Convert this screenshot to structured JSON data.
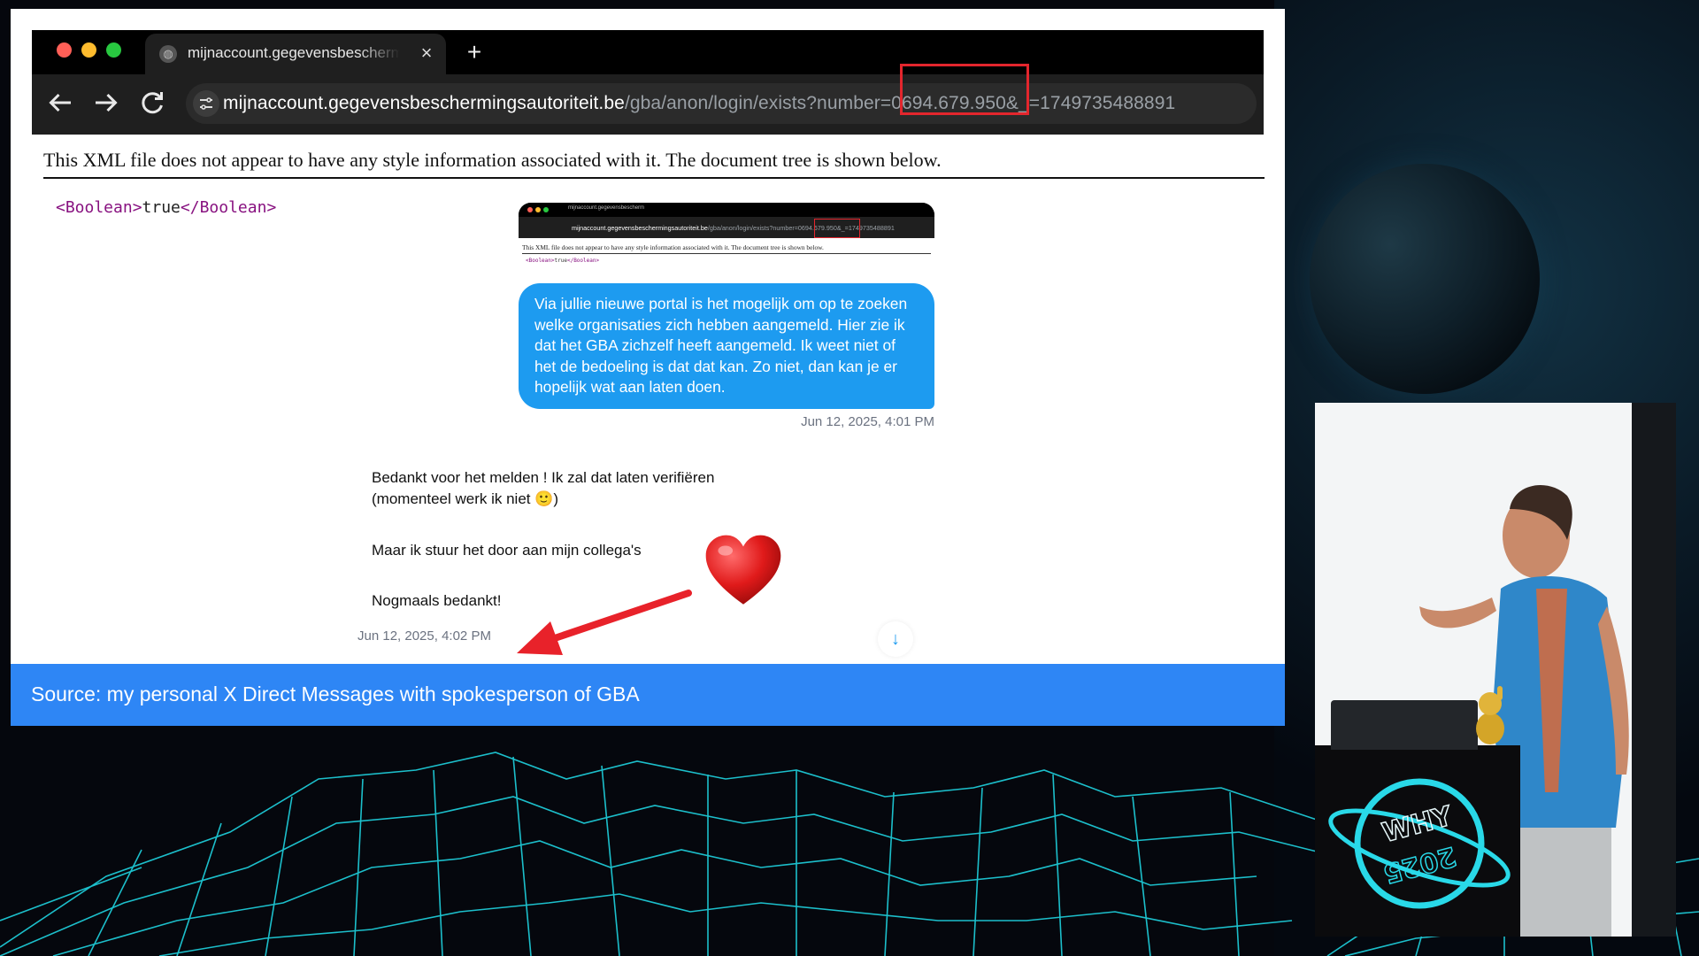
{
  "browser": {
    "tab_title": "mijnaccount.gegevensbescherm",
    "close_glyph": "×",
    "new_tab_glyph": "+",
    "url_host": "mijnaccount.gegevensbeschermingsautoriteit.be",
    "url_path": "/gba/anon/login/exists?number=0694.679.950&_=1749735488891",
    "highlighted_value": "0694.679.950"
  },
  "xml_page": {
    "notice": "This XML file does not appear to have any style information associated with it. The document tree is shown below.",
    "open_tag": "<Boolean>",
    "value": "true",
    "close_tag": "</Boolean>"
  },
  "dm": {
    "outgoing_message": "Via jullie nieuwe portal is het mogelijk om op te zoeken welke organisaties zich hebben aangemeld. Hier zie ik dat het GBA zichzelf heeft aangemeld. Ik weet niet of het de bedoeling is dat dat kan. Zo niet, dan kan je er hopelijk wat aan laten doen.",
    "outgoing_timestamp": "Jun 12, 2025, 4:01 PM",
    "incoming_messages": [
      "Bedankt voor het melden ! Ik zal dat laten verifiëren (momenteel werk ik niet 🙂)",
      "Maar ik stuur het door aan mijn collega's",
      "Nogmaals bedankt!"
    ],
    "incoming_timestamp": "Jun 12, 2025, 4:02 PM",
    "scroll_glyph": "↓"
  },
  "source_banner": "Source: my personal X Direct Messages with spokesperson of GBA",
  "stage_logo_text": [
    "WHY",
    "2025"
  ],
  "colors": {
    "accent_blue": "#1d9bf0",
    "banner_blue": "#2e86f5",
    "highlight_red": "#e3262d",
    "neon_cyan": "#29d9e8"
  },
  "icons": {
    "back": "arrow-left-icon",
    "forward": "arrow-right-icon",
    "reload": "reload-icon",
    "site_info": "tune-icon",
    "heart": "heart-icon",
    "red_arrow": "arrow-pointer-icon"
  }
}
